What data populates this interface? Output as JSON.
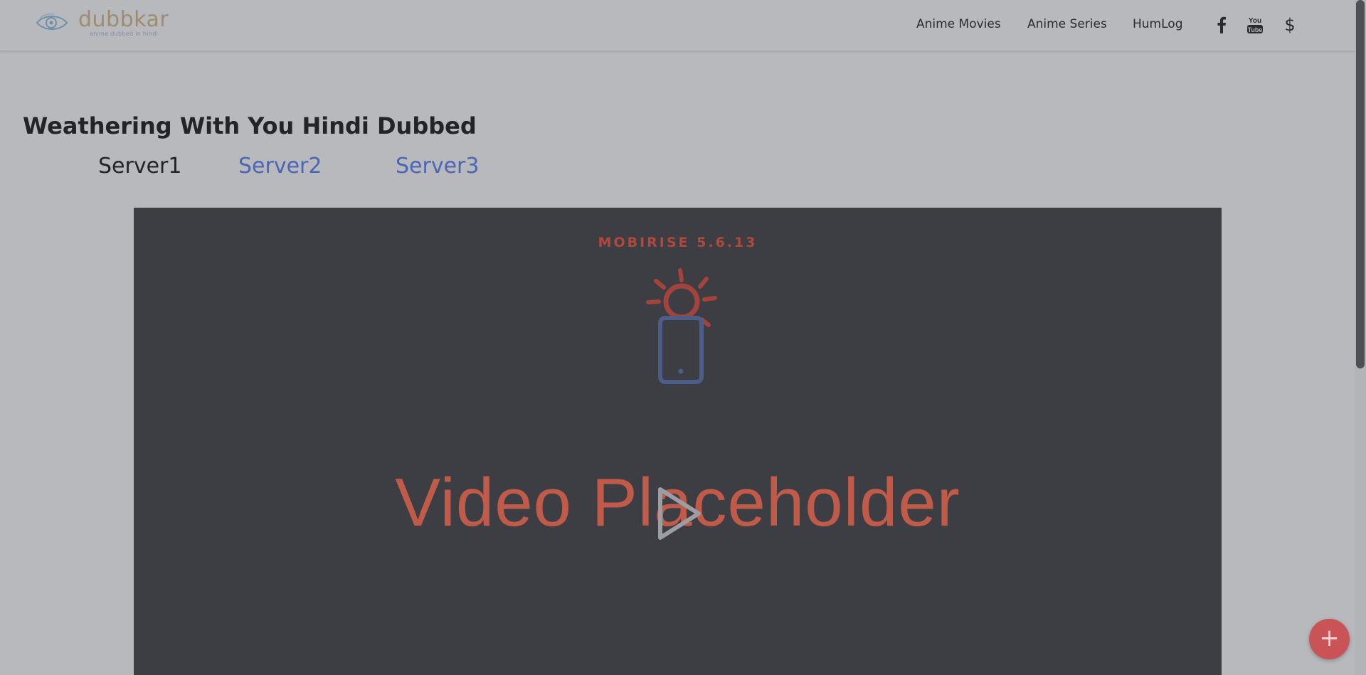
{
  "header": {
    "logo": {
      "name": "dubbkar",
      "tagline": "anime dubbed in hindi"
    },
    "nav": [
      {
        "label": "Anime Movies"
      },
      {
        "label": "Anime Series"
      },
      {
        "label": "HumLog"
      }
    ],
    "social": {
      "facebook_icon": "facebook-icon",
      "youtube_icon": "youtube-icon",
      "youtube_label": "You Tube",
      "donate_icon": "dollar-icon",
      "donate_symbol": "$"
    }
  },
  "main": {
    "title": "Weathering With You Hindi Dubbed",
    "servers": [
      {
        "label": "Server1",
        "active": true
      },
      {
        "label": "Server2",
        "active": false
      },
      {
        "label": "Server3",
        "active": false
      }
    ],
    "video": {
      "brand": "MOBIRISE 5.6.13",
      "placeholder_text": "Video Placeholder",
      "play_icon": "play-icon",
      "illustration_icon": "phone-sun-icon"
    }
  },
  "fab": {
    "symbol": "+",
    "icon": "plus-icon"
  },
  "colors": {
    "page_background": "#b8b9bc",
    "video_background": "#3d3e43",
    "link_blue": "#4a66b4",
    "placeholder_red": "#c05b4a",
    "fab_red": "#c95457"
  }
}
